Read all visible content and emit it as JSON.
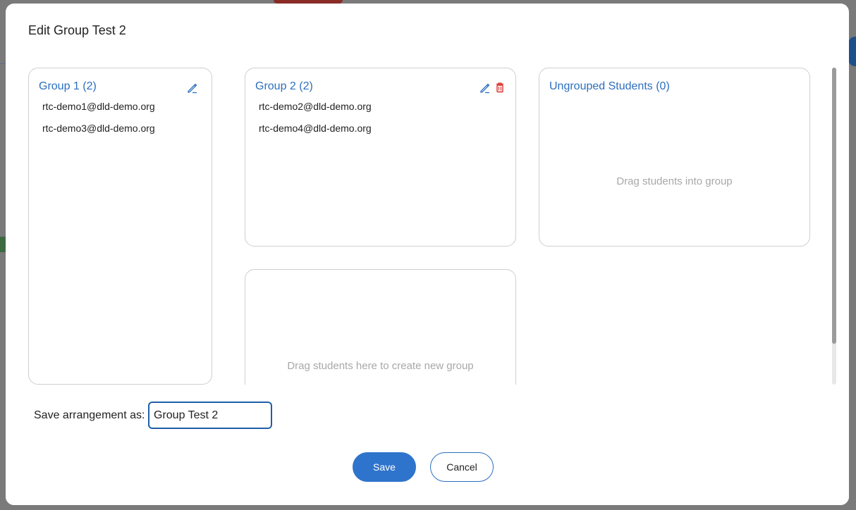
{
  "modal": {
    "title": "Edit Group Test 2"
  },
  "groups": [
    {
      "title": "Group 1 (2)",
      "members": [
        "rtc-demo1@dld-demo.org",
        "rtc-demo3@dld-demo.org"
      ],
      "actions": [
        "edit-icon"
      ]
    },
    {
      "title": "Group 2 (2)",
      "members": [
        "rtc-demo2@dld-demo.org",
        "rtc-demo4@dld-demo.org"
      ],
      "actions": [
        "edit-icon",
        "trash-icon"
      ]
    }
  ],
  "ungrouped": {
    "title": "Ungrouped Students (0)",
    "hint": "Drag students into group"
  },
  "new_group": {
    "hint": "Drag students here to create new group"
  },
  "arrangement": {
    "label": "Save arrangement as:",
    "value": "Group Test 2"
  },
  "buttons": {
    "save": "Save",
    "cancel": "Cancel"
  },
  "colors": {
    "accent": "#2c6fbe",
    "danger": "#d9302c",
    "hint": "#a8a8a8"
  }
}
